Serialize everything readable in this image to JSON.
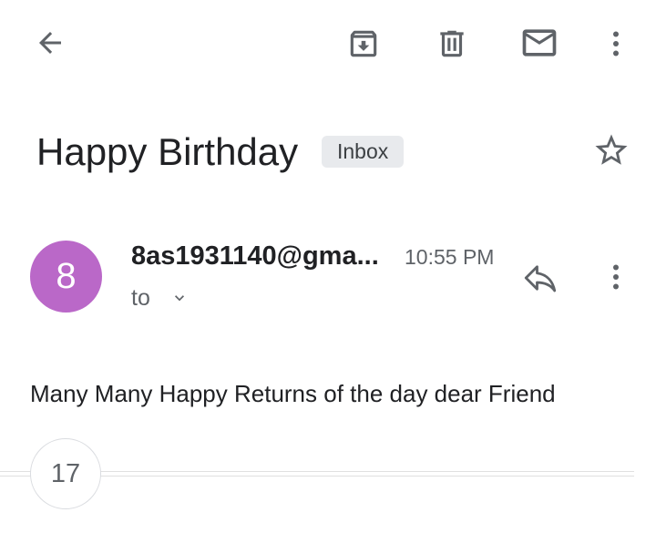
{
  "toolbar": {
    "back_icon": "arrow-left-icon",
    "archive_icon": "archive-icon",
    "delete_icon": "trash-icon",
    "mark_unread_icon": "mail-icon",
    "more_icon": "more-vert-icon"
  },
  "message": {
    "subject": "Happy Birthday",
    "label": "Inbox",
    "star_icon": "star-outline-icon",
    "sender_initial": "8",
    "avatar_color": "#ba68c8",
    "sender": "8as1931140@gma...",
    "time": "10:55 PM",
    "recipient_label": "to",
    "reply_icon": "reply-icon",
    "body": "Many Many Happy Returns of the day dear Friend"
  },
  "thread": {
    "collapsed_count": "17"
  }
}
